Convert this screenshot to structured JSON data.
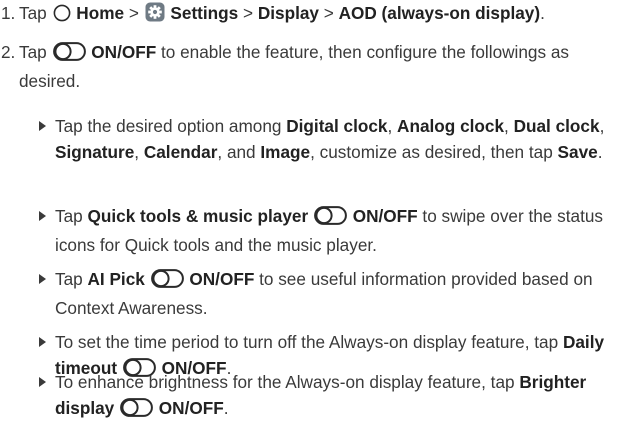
{
  "steps": [
    {
      "number": "1.",
      "parts": [
        {
          "t": "Tap "
        },
        {
          "icon": "home-circle-icon"
        },
        {
          "t": " "
        },
        {
          "b": "Home"
        },
        {
          "t": " > "
        },
        {
          "icon": "settings-gear-icon"
        },
        {
          "t": " "
        },
        {
          "b": "Settings"
        },
        {
          "t": " > "
        },
        {
          "b": "Display"
        },
        {
          "t": " > "
        },
        {
          "b": "AOD (always-on display)"
        },
        {
          "t": "."
        }
      ]
    },
    {
      "number": "2.",
      "parts": [
        {
          "t": "Tap "
        },
        {
          "icon": "toggle-switch-icon"
        },
        {
          "t": " "
        },
        {
          "b": "ON/OFF"
        },
        {
          "t": " to enable the feature, then configure the followings as desired."
        }
      ]
    }
  ],
  "bullets": [
    {
      "parts": [
        {
          "t": "Tap the desired option among "
        },
        {
          "b": "Digital clock"
        },
        {
          "t": ", "
        },
        {
          "b": "Analog clock"
        },
        {
          "t": ", "
        },
        {
          "b": "Dual clock"
        },
        {
          "t": ", "
        },
        {
          "b": "Signature"
        },
        {
          "t": ", "
        },
        {
          "b": "Calendar"
        },
        {
          "t": ", and "
        },
        {
          "b": "Image"
        },
        {
          "t": ", customize as desired, then tap "
        },
        {
          "b": "Save"
        },
        {
          "t": "."
        }
      ]
    },
    {
      "parts": [
        {
          "t": "Tap "
        },
        {
          "b": "Quick tools & music player"
        },
        {
          "t": " "
        },
        {
          "icon": "toggle-switch-icon"
        },
        {
          "t": " "
        },
        {
          "b": "ON/OFF"
        },
        {
          "t": " to swipe over the status icons for Quick tools and the music player."
        }
      ]
    },
    {
      "parts": [
        {
          "t": "Tap "
        },
        {
          "b": "AI Pick"
        },
        {
          "t": " "
        },
        {
          "icon": "toggle-switch-icon"
        },
        {
          "t": " "
        },
        {
          "b": "ON/OFF"
        },
        {
          "t": " to see useful information provided based on Context Awareness."
        }
      ]
    },
    {
      "parts": [
        {
          "t": "To set the time period to turn off the Always-on display feature, tap "
        },
        {
          "b": "Daily timeout"
        },
        {
          "t": " "
        },
        {
          "icon": "toggle-switch-icon"
        },
        {
          "t": " "
        },
        {
          "b": "ON/OFF"
        },
        {
          "t": "."
        }
      ]
    },
    {
      "parts": [
        {
          "t": "To enhance brightness for the Always-on display feature, tap "
        },
        {
          "b": "Brighter display"
        },
        {
          "t": " "
        },
        {
          "icon": "toggle-switch-icon"
        },
        {
          "t": " "
        },
        {
          "b": "ON/OFF"
        },
        {
          "t": "."
        }
      ]
    }
  ],
  "colors": {
    "text": "#3a3a3a",
    "emphasis": "#222222",
    "icon_stroke": "#2a2a2a",
    "settings_icon_bg": "#6f7a84"
  }
}
